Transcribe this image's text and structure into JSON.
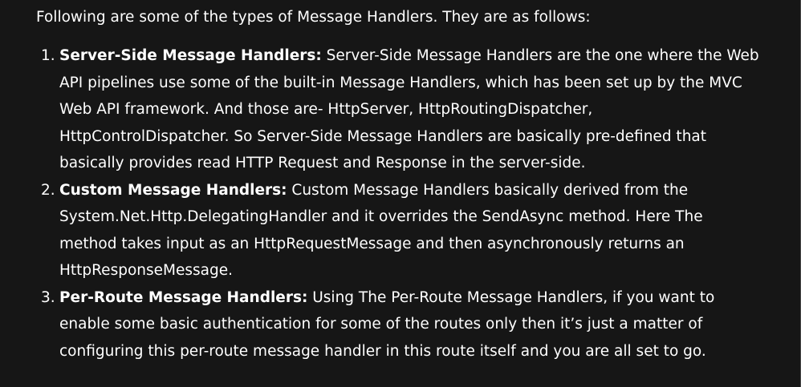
{
  "intro": "Following are some of the types of Message Handlers. They are as follows:",
  "items": [
    {
      "number": "1.",
      "term": "Server-Side Message Handlers:",
      "lines": [
        " Server-Side Message Handlers are the one where the Web",
        "API pipelines use some of the built-in Message Handlers, which has been set up by the MVC",
        "Web API framework. And those are- HttpServer, HttpRoutingDispatcher,",
        "HttpControlDispatcher. So Server-Side Message Handlers are basically pre-defined that",
        "basically provides read HTTP Request and Response in the server-side."
      ]
    },
    {
      "number": "2.",
      "term": "Custom Message Handlers:",
      "lines": [
        " Custom Message Handlers basically derived from the",
        "System.Net.Http.DelegatingHandler and it overrides the SendAsync method. Here The",
        "method takes input as an HttpRequestMessage and then asynchronously returns an",
        "HttpResponseMessage."
      ]
    },
    {
      "number": "3.",
      "term": "Per-Route Message Handlers:",
      "lines": [
        " Using The Per-Route Message Handlers, if you want to",
        "enable some basic authentication for some of the routes only then it’s just a matter of",
        "configuring this per-route message handler in this route itself and you are all set to go."
      ]
    }
  ]
}
